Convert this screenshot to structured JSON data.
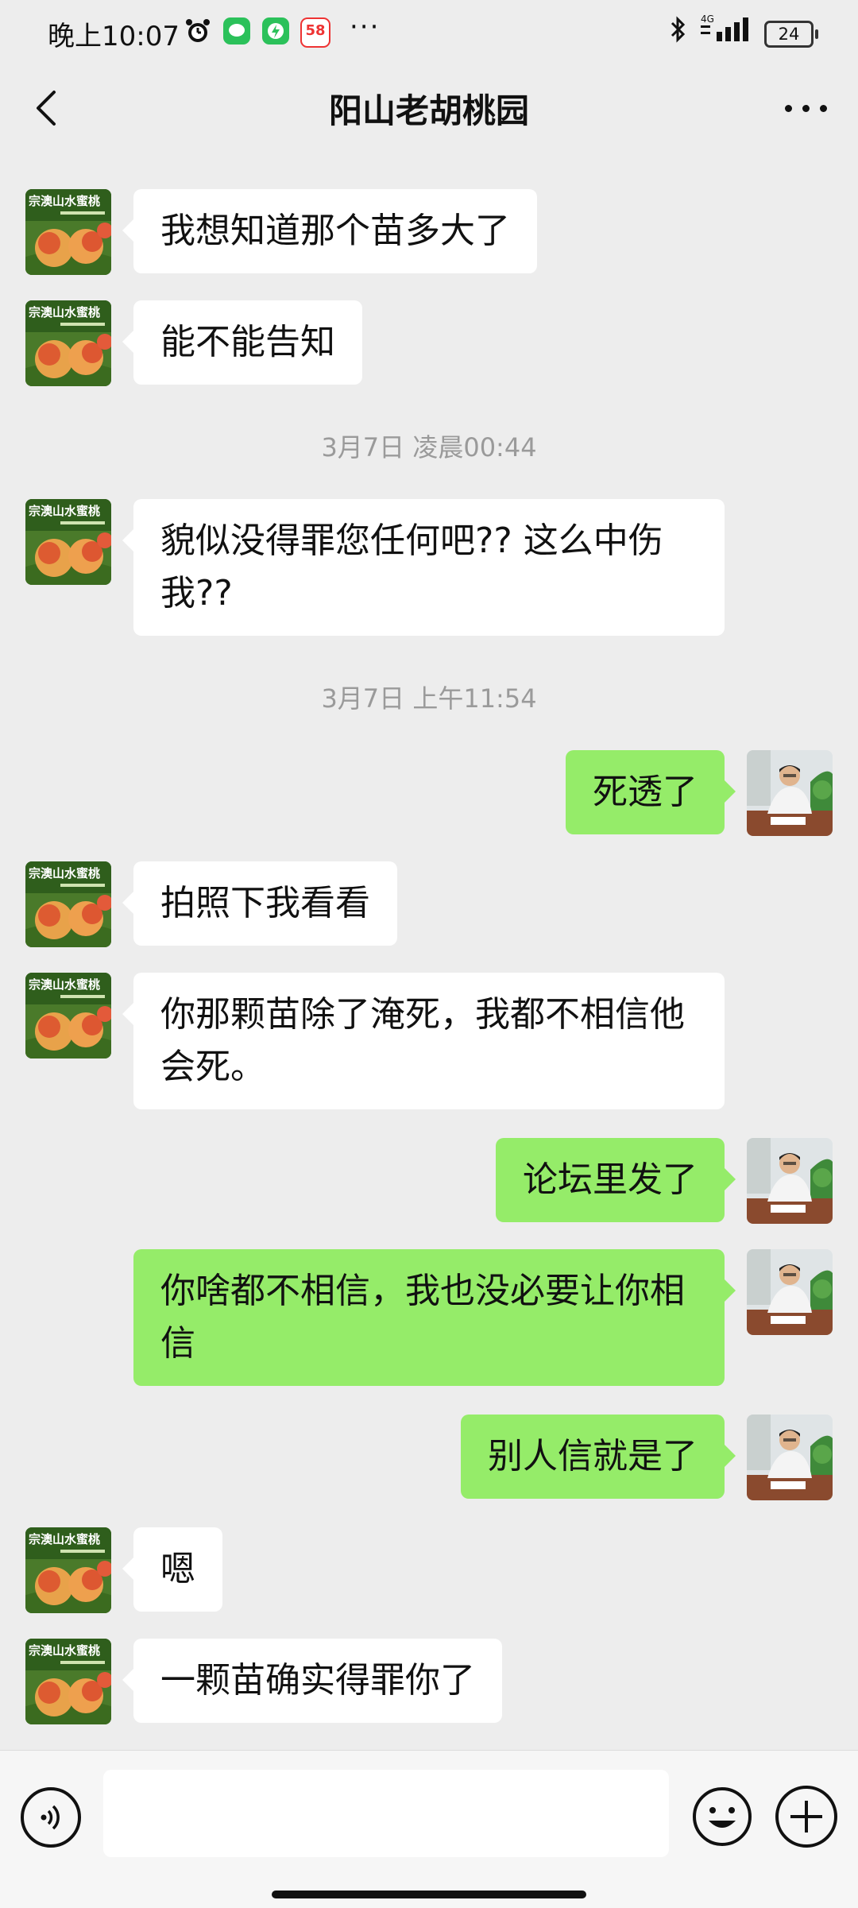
{
  "status_bar": {
    "time": "晚上10:07",
    "icons": [
      "alarm-icon",
      "wechat-notification-icon",
      "charging-app-icon",
      "58-app-icon"
    ],
    "app_58_label": "58",
    "more": "···",
    "network": "4G",
    "battery": "24"
  },
  "header": {
    "title": "阳山老胡桃园"
  },
  "messages": [
    {
      "side": "left",
      "text": "我想知道那个苗多大了"
    },
    {
      "side": "left",
      "text": "能不能告知"
    },
    {
      "type": "time",
      "text": "3月7日 凌晨00:44"
    },
    {
      "side": "left",
      "text": "貌似没得罪您任何吧?? 这么中伤我??"
    },
    {
      "type": "time",
      "text": "3月7日 上午11:54"
    },
    {
      "side": "right",
      "text": "死透了"
    },
    {
      "side": "left",
      "text": "拍照下我看看"
    },
    {
      "side": "left",
      "text": "你那颗苗除了淹死，我都不相信他会死。"
    },
    {
      "side": "right",
      "text": "论坛里发了"
    },
    {
      "side": "right",
      "text": "你啥都不相信，我也没必要让你相信"
    },
    {
      "side": "right",
      "text": "别人信就是了"
    },
    {
      "side": "left",
      "text": "嗯"
    },
    {
      "side": "left",
      "text": "一颗苗确实得罪你了"
    }
  ],
  "contact_avatar_text": "宗澳山水蜜桃",
  "input": {
    "value": "",
    "placeholder": ""
  },
  "colors": {
    "background": "#ededed",
    "incoming_bubble": "#ffffff",
    "outgoing_bubble": "#95ec69",
    "timestamp_text": "#9a9a9a"
  }
}
